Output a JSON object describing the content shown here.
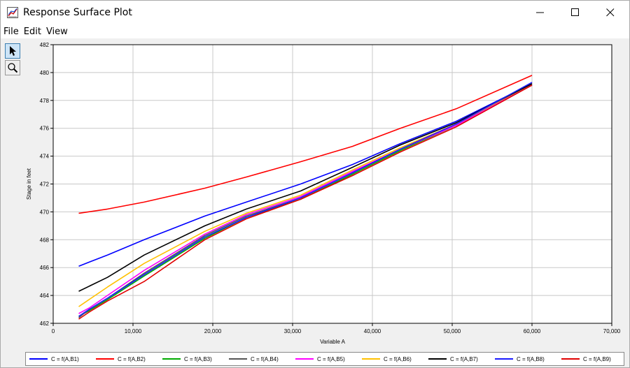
{
  "window": {
    "title": "Response Surface Plot"
  },
  "menu": {
    "items": [
      "File",
      "Edit",
      "View"
    ]
  },
  "toolbar": {
    "tools": [
      {
        "name": "pointer-tool",
        "icon": "arrow-pointer-icon",
        "active": true
      },
      {
        "name": "zoom-tool",
        "icon": "magnifier-icon",
        "active": false
      }
    ]
  },
  "chart_data": {
    "type": "line",
    "title": "",
    "xlabel": "Variable A",
    "ylabel": "Stage in feet",
    "xlim": [
      0,
      70000
    ],
    "ylim": [
      462,
      482
    ],
    "xticks": [
      0,
      10000,
      20000,
      30000,
      40000,
      50000,
      60000,
      70000
    ],
    "xtick_labels": [
      "0",
      "10,000",
      "20,000",
      "30,000",
      "40,000",
      "50,000",
      "60,000",
      "70,000"
    ],
    "yticks": [
      462,
      464,
      466,
      468,
      470,
      472,
      474,
      476,
      478,
      480,
      482
    ],
    "ytick_labels": [
      "462",
      "464",
      "466",
      "468",
      "470",
      "472",
      "474",
      "476",
      "478",
      "480",
      "482"
    ],
    "grid": true,
    "legend_position": "bottom",
    "series": [
      {
        "name": "C = f(A,B1)",
        "color": "#0000ff",
        "x": [
          3200,
          6800,
          11400,
          19000,
          24200,
          31000,
          37500,
          43500,
          50500,
          60000
        ],
        "y": [
          466.1,
          466.9,
          468.0,
          469.7,
          470.7,
          472.0,
          473.4,
          474.9,
          476.5,
          479.2
        ]
      },
      {
        "name": "C = f(A,B2)",
        "color": "#ff0000",
        "x": [
          3200,
          6800,
          11400,
          19000,
          24200,
          31000,
          37500,
          43500,
          50500,
          60000
        ],
        "y": [
          469.9,
          470.2,
          470.7,
          471.7,
          472.5,
          473.6,
          474.7,
          476.0,
          477.4,
          479.8
        ]
      },
      {
        "name": "C = f(A,B3)",
        "color": "#00aa00",
        "x": [
          3200,
          4500,
          6800,
          11400,
          19000,
          24200,
          31000,
          37500,
          43500,
          50500,
          60000
        ],
        "y": [
          462.5,
          462.9,
          463.7,
          465.4,
          468.1,
          469.6,
          470.9,
          472.7,
          474.4,
          476.2,
          479.1
        ]
      },
      {
        "name": "C = f(A,B4)",
        "color": "#555555",
        "x": [
          3200,
          4500,
          6800,
          11400,
          19000,
          24200,
          31000,
          37500,
          43500,
          50500,
          60000
        ],
        "y": [
          462.4,
          463.0,
          463.8,
          465.6,
          468.3,
          469.7,
          471.0,
          472.8,
          474.5,
          476.3,
          479.1
        ]
      },
      {
        "name": "C = f(A,B5)",
        "color": "#ff00ff",
        "x": [
          3200,
          4500,
          6800,
          11400,
          19000,
          24200,
          31000,
          37500,
          43500,
          50500,
          60000
        ],
        "y": [
          462.7,
          463.1,
          464.0,
          465.8,
          468.4,
          469.8,
          471.1,
          472.9,
          474.5,
          476.2,
          479.1
        ]
      },
      {
        "name": "C = f(A,B6)",
        "color": "#ffc000",
        "x": [
          3200,
          6800,
          11400,
          19000,
          24200,
          31000,
          37500,
          43500,
          50500,
          60000
        ],
        "y": [
          463.2,
          464.6,
          466.3,
          468.6,
          469.9,
          471.2,
          473.0,
          474.6,
          476.3,
          479.2
        ]
      },
      {
        "name": "C = f(A,B7)",
        "color": "#000000",
        "x": [
          3200,
          6800,
          11400,
          19000,
          24200,
          31000,
          37500,
          43500,
          50500,
          60000
        ],
        "y": [
          464.3,
          465.3,
          466.9,
          469.0,
          470.2,
          471.5,
          473.2,
          474.8,
          476.4,
          479.2
        ]
      },
      {
        "name": "C = f(A,B8)",
        "color": "#1a1aff",
        "x": [
          3200,
          4500,
          6800,
          11400,
          19000,
          24200,
          31000,
          37500,
          43500,
          50500,
          60000
        ],
        "y": [
          462.5,
          463.0,
          463.8,
          465.5,
          468.2,
          469.6,
          471.0,
          472.8,
          474.5,
          476.3,
          479.3
        ]
      },
      {
        "name": "C = f(A,B9)",
        "color": "#e00000",
        "x": [
          3200,
          4500,
          6800,
          11400,
          19000,
          24200,
          31000,
          37500,
          43500,
          50500,
          60000
        ],
        "y": [
          462.3,
          462.8,
          463.6,
          465.0,
          468.0,
          469.5,
          470.9,
          472.6,
          474.3,
          476.1,
          479.1
        ]
      }
    ]
  }
}
